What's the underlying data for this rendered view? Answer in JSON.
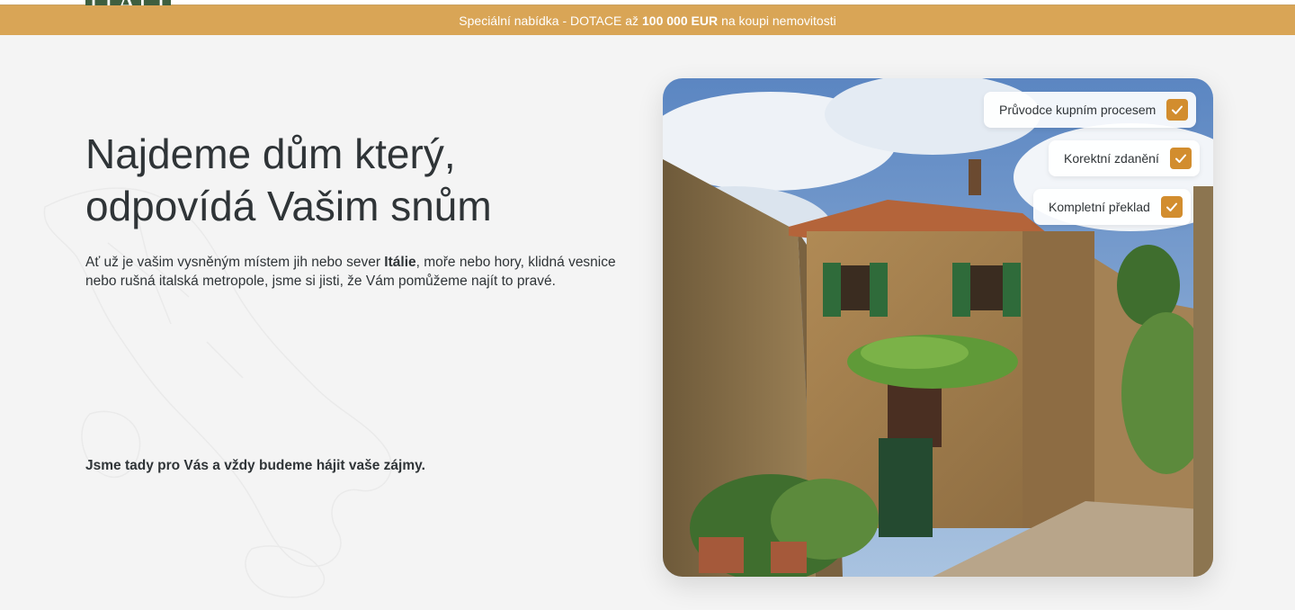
{
  "logo": {
    "text": "ITALI"
  },
  "promo": {
    "prefix": "Speciální nabídka - DOTACE až",
    "highlight": "100 000 EUR",
    "suffix": "na koupi nemovitosti"
  },
  "hero": {
    "title_line1": "Najdeme dům který,",
    "title_line2": "odpovídá Vašim snům",
    "text_before": "Ať už je vašim vysněným místem jih nebo sever",
    "text_bold": "Itálie",
    "text_after": ", moře nebo hory, klidná vesnice nebo rušná italská metropole, jsme si jisti, že Vám pomůžeme najít to pravé.",
    "tagline": "Jsme tady pro Vás a vždy budeme hájit vaše zájmy."
  },
  "badges": [
    {
      "label": "Průvodce kupním procesem",
      "icon": "check-icon"
    },
    {
      "label": "Korektní zdanění",
      "icon": "check-icon"
    },
    {
      "label": "Kompletní překlad",
      "icon": "check-icon"
    }
  ],
  "colors": {
    "accent": "#d9a556",
    "check": "#d28d2e",
    "logo": "#3e5f3f"
  }
}
